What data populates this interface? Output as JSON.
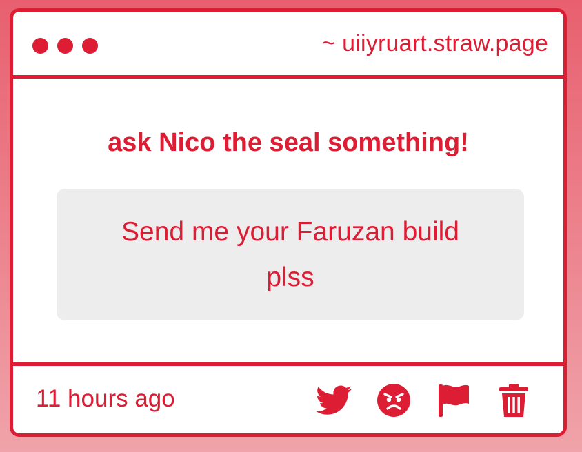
{
  "window": {
    "url": "~ uiiyruart.straw.page"
  },
  "main": {
    "heading": "ask Nico the seal something!",
    "message": "Send me your Faruzan build plss"
  },
  "footer": {
    "timestamp": "11 hours ago",
    "actions": [
      {
        "icon": "twitter-icon"
      },
      {
        "icon": "angry-face-icon"
      },
      {
        "icon": "flag-icon"
      },
      {
        "icon": "trash-icon"
      }
    ]
  },
  "colors": {
    "accent": "#dc1d34",
    "message_bg": "#eeedee",
    "background_top": "#e8606f",
    "background_bottom": "#f0a3aa"
  }
}
